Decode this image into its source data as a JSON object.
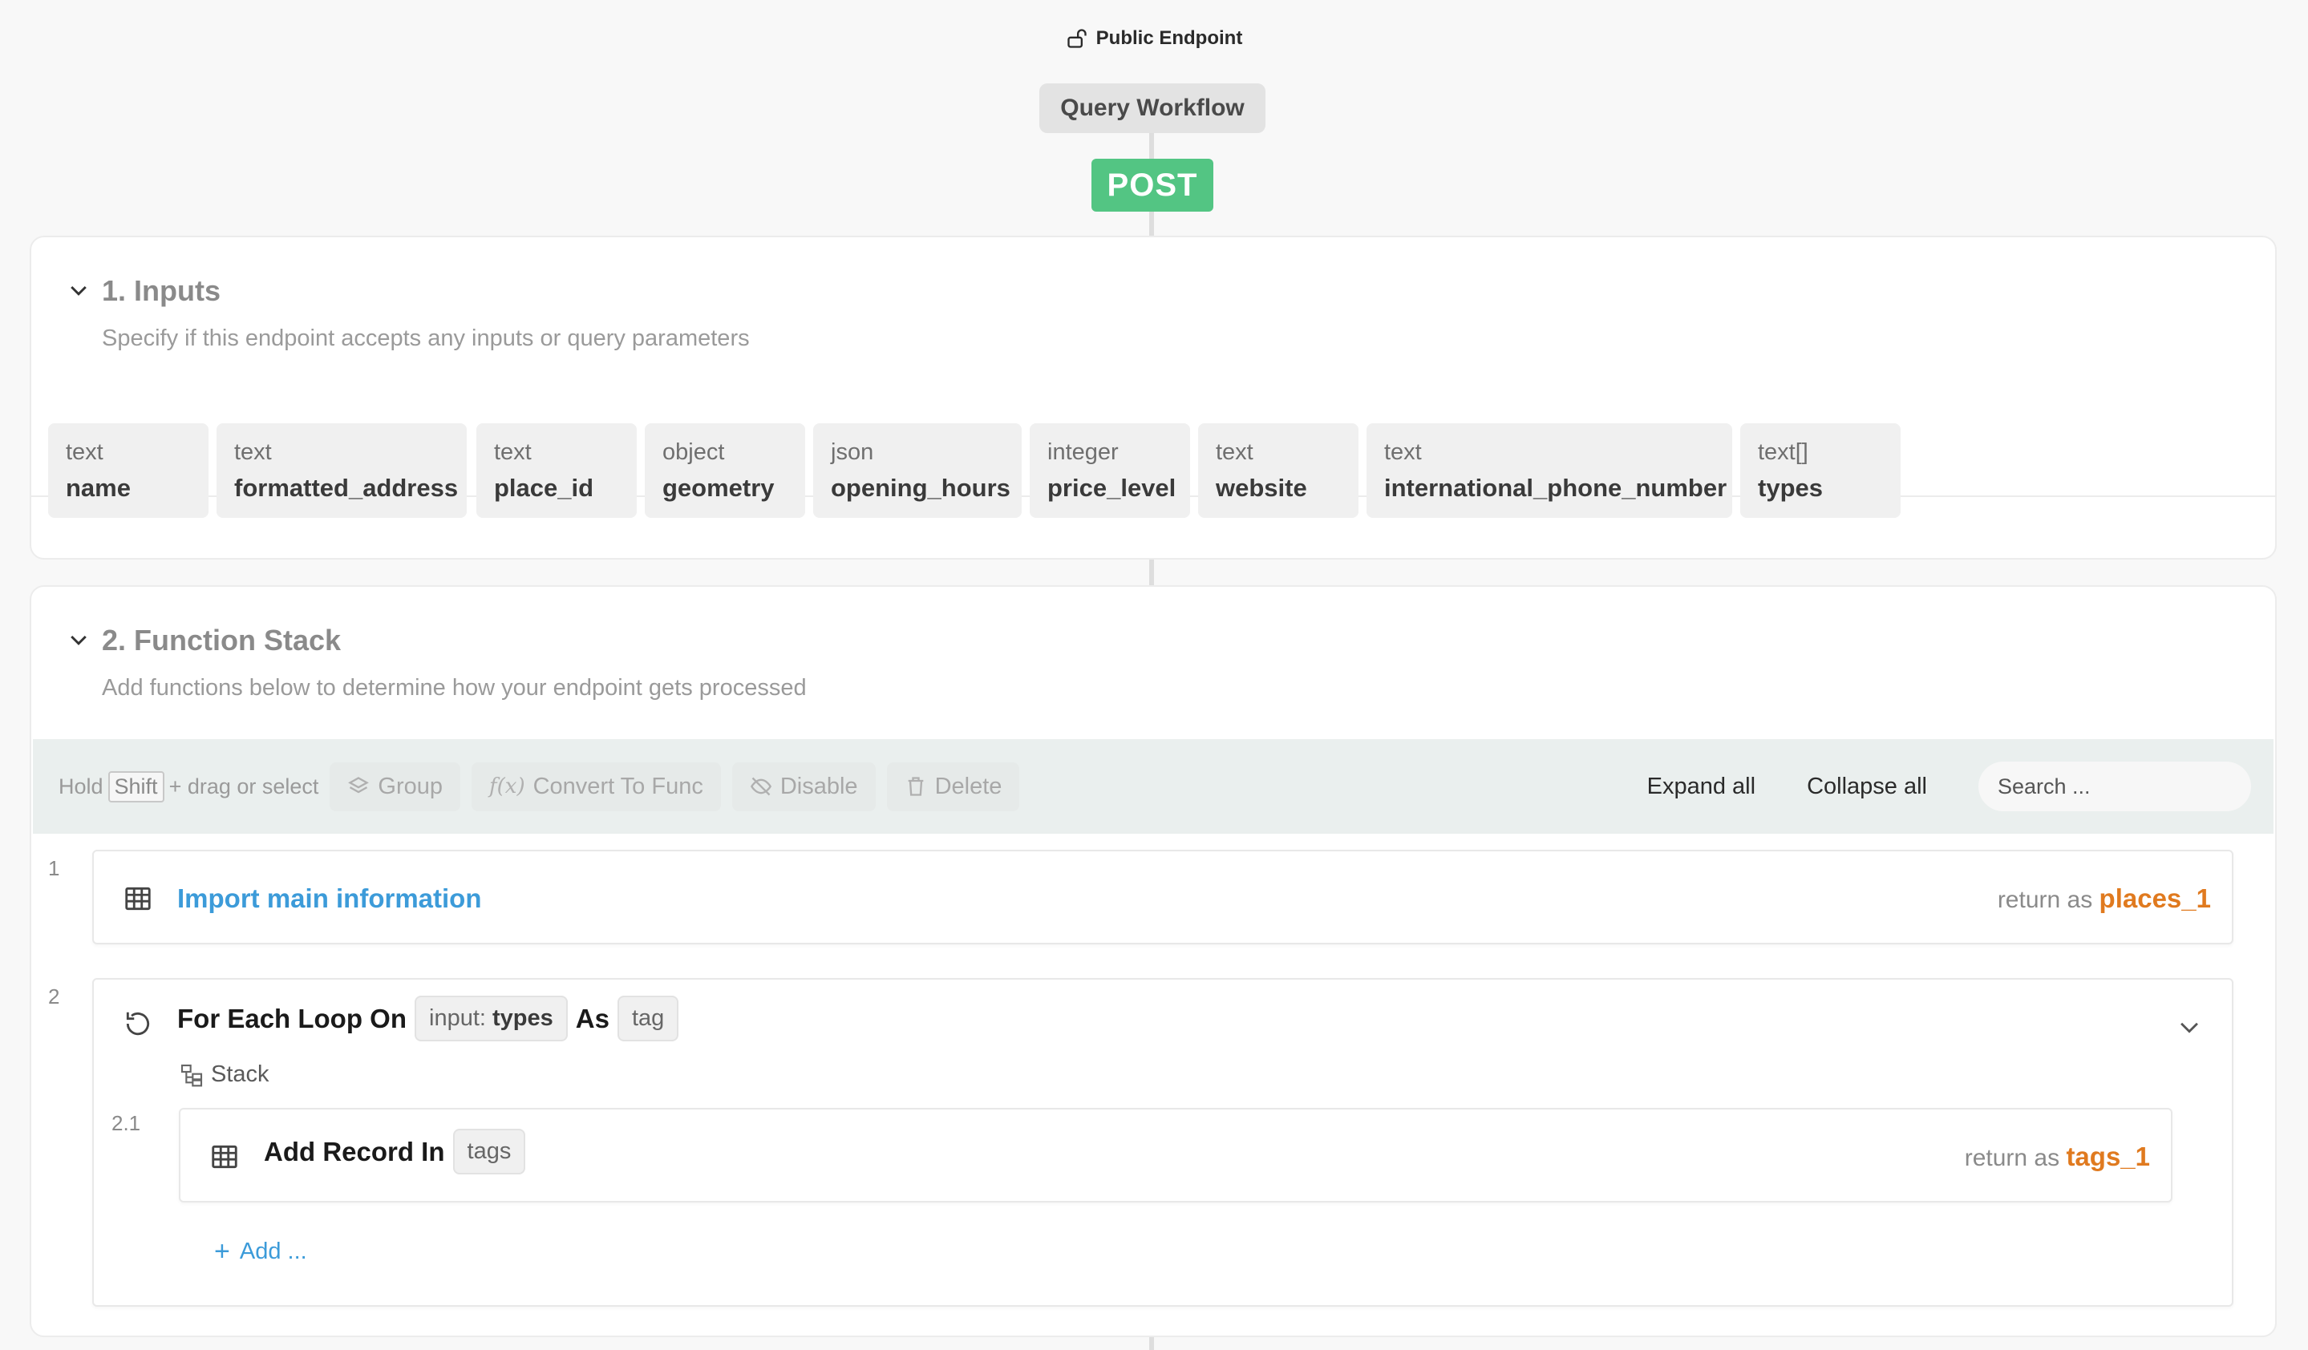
{
  "header": {
    "public_label": "Public Endpoint",
    "workflow_name": "Query Workflow",
    "method": "POST"
  },
  "inputs_section": {
    "title": "1. Inputs",
    "subtitle": "Specify if this endpoint accepts any inputs or query parameters",
    "fields": [
      {
        "type": "text",
        "name": "name"
      },
      {
        "type": "text",
        "name": "formatted_address"
      },
      {
        "type": "text",
        "name": "place_id"
      },
      {
        "type": "object",
        "name": "geometry"
      },
      {
        "type": "json",
        "name": "opening_hours"
      },
      {
        "type": "integer",
        "name": "price_level"
      },
      {
        "type": "text",
        "name": "website"
      },
      {
        "type": "text",
        "name": "international_phone_number"
      },
      {
        "type": "text[]",
        "name": "types"
      }
    ]
  },
  "function_section": {
    "title": "2. Function Stack",
    "subtitle": "Add functions below to determine how your endpoint gets processed"
  },
  "toolbar": {
    "hint_prefix": "Hold",
    "hint_key": "Shift",
    "hint_suffix": "+ drag or select",
    "group": "Group",
    "convert": "Convert To Func",
    "disable": "Disable",
    "delete": "Delete",
    "expand_all": "Expand all",
    "collapse_all": "Collapse all",
    "search_placeholder": "Search ..."
  },
  "functions": {
    "f1": {
      "index": "1",
      "title": "Import main information",
      "return_prefix": "return as",
      "return_var": "places_1"
    },
    "f2": {
      "index": "2",
      "title_a": "For Each Loop On",
      "pill_input_prefix": "input:",
      "pill_input_value": "types",
      "title_b": "As",
      "pill_as": "tag",
      "stack_label": "Stack",
      "sub": {
        "index": "2.1",
        "title": "Add Record In",
        "pill": "tags",
        "return_prefix": "return as",
        "return_var": "tags_1"
      },
      "add_label": "Add ..."
    }
  }
}
